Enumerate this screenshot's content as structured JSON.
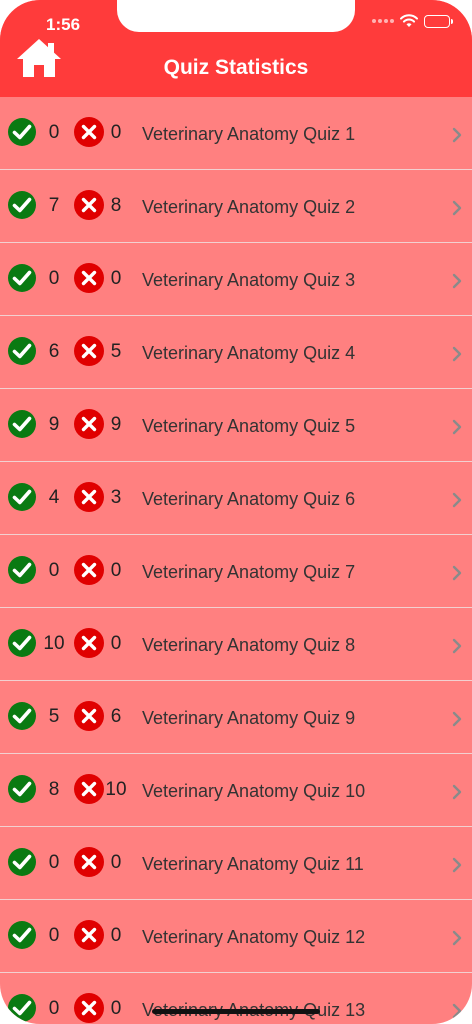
{
  "status_bar": {
    "time": "1:56"
  },
  "header": {
    "title": "Quiz Statistics",
    "home_icon": "home-icon"
  },
  "colors": {
    "header_bg": "#ff3b3b",
    "list_bg": "#ff8080",
    "correct": "#0a7a12",
    "incorrect": "#e00000"
  },
  "quizzes": [
    {
      "correct": "0",
      "incorrect": "0",
      "name": "Veterinary Anatomy Quiz 1"
    },
    {
      "correct": "7",
      "incorrect": "8",
      "name": "Veterinary Anatomy Quiz 2"
    },
    {
      "correct": "0",
      "incorrect": "0",
      "name": "Veterinary Anatomy Quiz 3"
    },
    {
      "correct": "6",
      "incorrect": "5",
      "name": "Veterinary Anatomy Quiz 4"
    },
    {
      "correct": "9",
      "incorrect": "9",
      "name": "Veterinary Anatomy Quiz 5"
    },
    {
      "correct": "4",
      "incorrect": "3",
      "name": "Veterinary Anatomy Quiz 6"
    },
    {
      "correct": "0",
      "incorrect": "0",
      "name": "Veterinary Anatomy Quiz 7"
    },
    {
      "correct": "10",
      "incorrect": "0",
      "name": "Veterinary Anatomy Quiz 8"
    },
    {
      "correct": "5",
      "incorrect": "6",
      "name": "Veterinary Anatomy Quiz 9"
    },
    {
      "correct": "8",
      "incorrect": "10",
      "name": "Veterinary Anatomy Quiz 10"
    },
    {
      "correct": "0",
      "incorrect": "0",
      "name": "Veterinary Anatomy Quiz 11"
    },
    {
      "correct": "0",
      "incorrect": "0",
      "name": "Veterinary Anatomy Quiz 12"
    },
    {
      "correct": "0",
      "incorrect": "0",
      "name": "Veterinary Anatomy Quiz 13"
    }
  ]
}
